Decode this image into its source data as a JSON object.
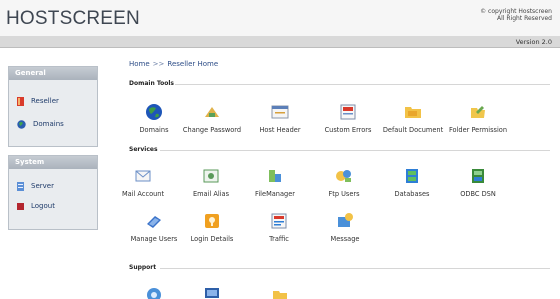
{
  "header": {
    "logo": "HOSTSCREEN",
    "copyright_line1": "© copyright Hostscreen",
    "copyright_line2": "All Right Reserved",
    "version": "Version 2.0"
  },
  "sidebar": {
    "general": {
      "title": "General",
      "items": [
        {
          "label": "Reseller",
          "icon": "reseller-icon"
        },
        {
          "label": "Domains",
          "icon": "domains-icon"
        }
      ]
    },
    "system": {
      "title": "System",
      "items": [
        {
          "label": "Server",
          "icon": "server-icon"
        },
        {
          "label": "Logout",
          "icon": "logout-icon"
        }
      ]
    }
  },
  "breadcrumb": {
    "home": "Home",
    "separator": ">>",
    "current": "Reseller Home"
  },
  "sections": {
    "domain_tools": {
      "title": "Domain Tools",
      "items": [
        {
          "label": "Domains",
          "icon": "globe-icon"
        },
        {
          "label": "Change Password",
          "icon": "key-icon"
        },
        {
          "label": "Host Header",
          "icon": "host-header-icon"
        },
        {
          "label": "Custom Errors",
          "icon": "custom-errors-icon"
        },
        {
          "label": "Default Document",
          "icon": "default-document-icon"
        },
        {
          "label": "Folder Permission",
          "icon": "folder-permission-icon"
        }
      ]
    },
    "services": {
      "title": "Services",
      "items": [
        {
          "label": "Mail Account",
          "icon": "mail-account-icon"
        },
        {
          "label": "Email Alias",
          "icon": "email-alias-icon"
        },
        {
          "label": "FileManager",
          "icon": "file-manager-icon"
        },
        {
          "label": "Ftp Users",
          "icon": "ftp-users-icon"
        },
        {
          "label": "Databases",
          "icon": "database-icon"
        },
        {
          "label": "ODBC DSN",
          "icon": "odbc-icon"
        },
        {
          "label": "Manage Users",
          "icon": "manage-users-icon"
        },
        {
          "label": "Login Details",
          "icon": "login-details-icon"
        },
        {
          "label": "Traffic",
          "icon": "traffic-icon"
        },
        {
          "label": "Message",
          "icon": "message-icon"
        }
      ]
    },
    "support": {
      "title": "Support",
      "items": [
        {
          "icon": "support-gear-icon"
        },
        {
          "icon": "support-monitor-icon"
        },
        {
          "icon": "support-folder-icon"
        }
      ]
    }
  },
  "colors": {
    "link": "#2d4d87",
    "panel_header": "#aab2bc",
    "version_bar": "#d9d9d9"
  }
}
